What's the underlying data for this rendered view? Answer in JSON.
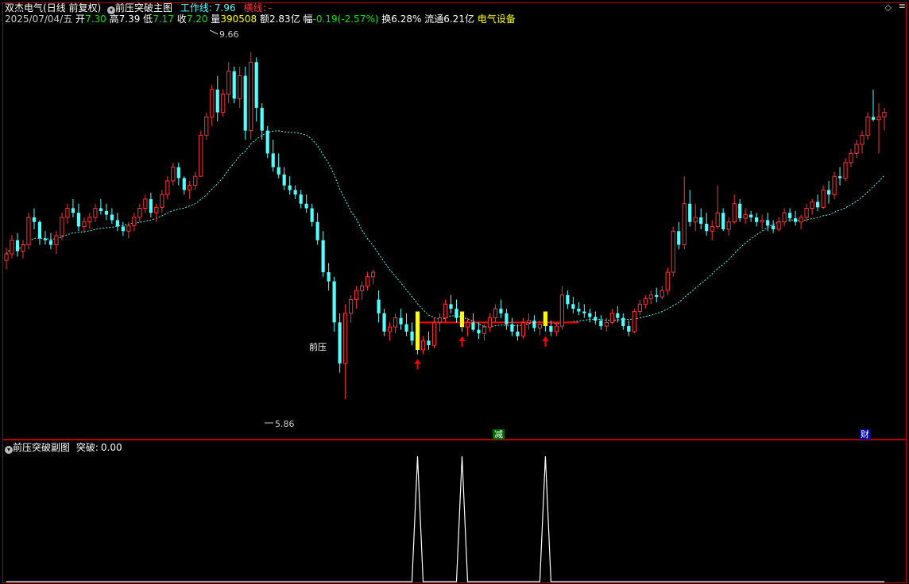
{
  "header": {
    "stock_name": "双杰电气",
    "period": "(日线 前复权)",
    "indicator_title": "前压突破主图",
    "work_line_label": "工作线:",
    "work_line_value": "7.96",
    "hline_label": "横线:",
    "hline_value": "-",
    "date": "2025/07/04/五",
    "open_label": "开",
    "open": "7.30",
    "high_label": "高",
    "high": "7.39",
    "low_label": "低",
    "low": "7.17",
    "close_label": "收",
    "close": "7.20",
    "volume_label": "量",
    "volume": "390508",
    "amount_label": "额",
    "amount": "2.83亿",
    "change_label": "幅",
    "change": "-0.19(-2.57%)",
    "turnover_label": "换",
    "turnover": "6.28%",
    "float_label": "流通",
    "float": "6.21亿",
    "sector": "电气设备"
  },
  "sub_header": {
    "title": "前压突破副图",
    "signal_label": "突破:",
    "signal_value": "0.00"
  },
  "annotations": {
    "high_label": "9.66",
    "low_label": "5.86",
    "pressure_label": "前压",
    "event_reduce": "减",
    "event_finance": "财"
  },
  "icons": {
    "indicator_toggle": "chevron-circle-icon",
    "corner": "diamond-icon"
  },
  "colors": {
    "up": "#ff3232",
    "down": "#54ffff",
    "ma": "#54ffff",
    "signal_bar": "#ffff00",
    "pressure_line": "#ff0000",
    "arrow": "#ff0000",
    "panel_border": "#b40000",
    "sub_line": "#ffffff"
  },
  "chart_data": [
    {
      "type": "candlestick",
      "title": "前压突破主图",
      "y_range": [
        5.6,
        9.9
      ],
      "candles": [
        [
          7.38,
          7.52,
          7.28,
          7.45
        ],
        [
          7.45,
          7.66,
          7.4,
          7.6
        ],
        [
          7.6,
          7.68,
          7.42,
          7.48
        ],
        [
          7.48,
          7.6,
          7.4,
          7.55
        ],
        [
          7.55,
          7.9,
          7.5,
          7.85
        ],
        [
          7.85,
          7.95,
          7.72,
          7.8
        ],
        [
          7.8,
          7.82,
          7.55,
          7.62
        ],
        [
          7.62,
          7.7,
          7.55,
          7.6
        ],
        [
          7.6,
          7.68,
          7.5,
          7.55
        ],
        [
          7.55,
          7.7,
          7.45,
          7.65
        ],
        [
          7.65,
          7.9,
          7.6,
          7.85
        ],
        [
          7.85,
          8.0,
          7.78,
          7.95
        ],
        [
          7.95,
          8.05,
          7.85,
          7.9
        ],
        [
          7.9,
          8.0,
          7.7,
          7.75
        ],
        [
          7.75,
          7.85,
          7.68,
          7.8
        ],
        [
          7.8,
          7.9,
          7.72,
          7.85
        ],
        [
          7.85,
          8.0,
          7.8,
          7.95
        ],
        [
          7.95,
          8.05,
          7.88,
          7.92
        ],
        [
          7.92,
          8.0,
          7.82,
          7.88
        ],
        [
          7.88,
          7.95,
          7.78,
          7.82
        ],
        [
          7.82,
          7.9,
          7.7,
          7.75
        ],
        [
          7.75,
          7.8,
          7.65,
          7.7
        ],
        [
          7.7,
          7.8,
          7.62,
          7.76
        ],
        [
          7.76,
          7.9,
          7.7,
          7.85
        ],
        [
          7.85,
          8.0,
          7.8,
          7.95
        ],
        [
          7.95,
          8.1,
          7.9,
          8.05
        ],
        [
          8.05,
          8.12,
          7.85,
          7.9
        ],
        [
          7.9,
          8.0,
          7.8,
          7.96
        ],
        [
          7.96,
          8.15,
          7.9,
          8.1
        ],
        [
          8.1,
          8.3,
          8.05,
          8.25
        ],
        [
          8.25,
          8.45,
          8.2,
          8.4
        ],
        [
          8.4,
          8.45,
          8.2,
          8.28
        ],
        [
          8.28,
          8.3,
          8.1,
          8.15
        ],
        [
          8.15,
          8.25,
          8.05,
          8.2
        ],
        [
          8.2,
          8.35,
          8.15,
          8.3
        ],
        [
          8.3,
          8.8,
          8.3,
          8.75
        ],
        [
          8.75,
          9.0,
          8.7,
          8.95
        ],
        [
          8.95,
          9.3,
          8.85,
          9.25
        ],
        [
          9.25,
          9.4,
          8.9,
          9.0
        ],
        [
          9.0,
          9.25,
          8.95,
          9.2
        ],
        [
          9.2,
          9.55,
          9.1,
          9.45
        ],
        [
          9.45,
          9.5,
          9.1,
          9.15
        ],
        [
          9.15,
          9.5,
          9.05,
          9.4
        ],
        [
          9.4,
          9.5,
          8.7,
          8.8
        ],
        [
          8.8,
          9.66,
          8.7,
          9.55
        ],
        [
          9.55,
          9.6,
          8.9,
          9.05
        ],
        [
          9.05,
          9.1,
          8.7,
          8.8
        ],
        [
          8.8,
          8.85,
          8.5,
          8.55
        ],
        [
          8.55,
          8.7,
          8.35,
          8.4
        ],
        [
          8.4,
          8.55,
          8.28,
          8.32
        ],
        [
          8.32,
          8.4,
          8.15,
          8.2
        ],
        [
          8.2,
          8.3,
          8.1,
          8.15
        ],
        [
          8.15,
          8.2,
          8.05,
          8.1
        ],
        [
          8.1,
          8.15,
          7.95,
          8.0
        ],
        [
          8.0,
          8.1,
          7.9,
          7.95
        ],
        [
          7.95,
          8.0,
          7.75,
          7.8
        ],
        [
          7.8,
          7.9,
          7.55,
          7.6
        ],
        [
          7.6,
          7.7,
          7.2,
          7.25
        ],
        [
          7.25,
          7.35,
          7.05,
          7.15
        ],
        [
          7.15,
          7.2,
          6.6,
          6.7
        ],
        [
          6.7,
          6.8,
          6.15,
          6.25
        ],
        [
          6.25,
          6.9,
          5.86,
          6.8
        ],
        [
          6.8,
          7.0,
          6.7,
          6.95
        ],
        [
          6.95,
          7.1,
          6.85,
          7.05
        ],
        [
          7.05,
          7.15,
          6.95,
          7.1
        ],
        [
          7.1,
          7.25,
          7.05,
          7.2
        ],
        [
          7.2,
          7.28,
          7.12,
          7.25
        ],
        [
          6.95,
          7.05,
          6.7,
          6.8
        ],
        [
          6.8,
          6.85,
          6.55,
          6.6
        ],
        [
          6.6,
          6.7,
          6.5,
          6.65
        ],
        [
          6.65,
          6.8,
          6.58,
          6.75
        ],
        [
          6.75,
          6.85,
          6.62,
          6.68
        ],
        [
          6.68,
          6.8,
          6.55,
          6.6
        ],
        [
          6.6,
          6.7,
          6.45,
          6.5
        ],
        [
          6.5,
          6.55,
          6.35,
          6.4
        ],
        [
          6.4,
          6.55,
          6.35,
          6.5
        ],
        [
          6.5,
          6.6,
          6.4,
          6.45
        ],
        [
          6.45,
          6.75,
          6.42,
          6.7
        ],
        [
          6.7,
          6.8,
          6.6,
          6.75
        ],
        [
          6.75,
          6.95,
          6.7,
          6.9
        ],
        [
          6.9,
          7.0,
          6.8,
          6.85
        ],
        [
          6.85,
          6.95,
          6.7,
          6.75
        ],
        [
          6.75,
          6.8,
          6.6,
          6.65
        ],
        [
          6.65,
          6.75,
          6.55,
          6.7
        ],
        [
          6.7,
          6.8,
          6.6,
          6.62
        ],
        [
          6.62,
          6.7,
          6.52,
          6.58
        ],
        [
          6.58,
          6.68,
          6.5,
          6.65
        ],
        [
          6.65,
          6.8,
          6.6,
          6.75
        ],
        [
          6.75,
          6.9,
          6.7,
          6.85
        ],
        [
          6.85,
          6.95,
          6.75,
          6.8
        ],
        [
          6.8,
          6.85,
          6.62,
          6.68
        ],
        [
          6.68,
          6.75,
          6.55,
          6.6
        ],
        [
          6.6,
          6.68,
          6.5,
          6.55
        ],
        [
          6.55,
          6.75,
          6.52,
          6.7
        ],
        [
          6.7,
          6.8,
          6.62,
          6.72
        ],
        [
          6.72,
          6.78,
          6.6,
          6.64
        ],
        [
          6.64,
          6.72,
          6.56,
          6.68
        ],
        [
          6.68,
          6.75,
          6.6,
          6.66
        ],
        [
          6.66,
          6.72,
          6.55,
          6.6
        ],
        [
          6.6,
          6.7,
          6.55,
          6.66
        ],
        [
          6.66,
          7.1,
          6.62,
          7.0
        ],
        [
          7.0,
          7.05,
          6.85,
          6.9
        ],
        [
          6.9,
          6.98,
          6.8,
          6.85
        ],
        [
          6.85,
          6.92,
          6.78,
          6.82
        ],
        [
          6.82,
          6.9,
          6.75,
          6.8
        ],
        [
          6.8,
          6.85,
          6.7,
          6.76
        ],
        [
          6.76,
          6.82,
          6.68,
          6.72
        ],
        [
          6.72,
          6.78,
          6.62,
          6.66
        ],
        [
          6.66,
          6.75,
          6.6,
          6.7
        ],
        [
          6.7,
          6.85,
          6.68,
          6.8
        ],
        [
          6.8,
          6.88,
          6.7,
          6.75
        ],
        [
          6.75,
          6.8,
          6.62,
          6.66
        ],
        [
          6.66,
          6.72,
          6.55,
          6.6
        ],
        [
          6.6,
          6.85,
          6.58,
          6.82
        ],
        [
          6.82,
          6.95,
          6.78,
          6.9
        ],
        [
          6.9,
          7.0,
          6.85,
          6.96
        ],
        [
          6.96,
          7.05,
          6.9,
          7.0
        ],
        [
          7.0,
          7.08,
          6.92,
          6.98
        ],
        [
          6.98,
          7.1,
          6.95,
          7.05
        ],
        [
          7.05,
          7.3,
          7.0,
          7.25
        ],
        [
          7.25,
          7.75,
          7.2,
          7.7
        ],
        [
          7.7,
          7.8,
          7.5,
          7.55
        ],
        [
          7.55,
          8.3,
          7.5,
          8.0
        ],
        [
          8.0,
          8.15,
          7.75,
          7.8
        ],
        [
          7.8,
          8.0,
          7.7,
          7.85
        ],
        [
          7.85,
          7.95,
          7.72,
          7.78
        ],
        [
          7.78,
          7.9,
          7.65,
          7.7
        ],
        [
          7.7,
          7.82,
          7.6,
          7.75
        ],
        [
          7.75,
          8.2,
          7.72,
          7.9
        ],
        [
          7.9,
          7.95,
          7.7,
          7.72
        ],
        [
          7.72,
          7.85,
          7.65,
          7.8
        ],
        [
          7.8,
          8.1,
          7.78,
          8.0
        ],
        [
          8.0,
          8.05,
          7.8,
          7.84
        ],
        [
          7.84,
          7.95,
          7.78,
          7.88
        ],
        [
          7.88,
          7.92,
          7.8,
          7.85
        ],
        [
          7.85,
          7.9,
          7.75,
          7.8
        ],
        [
          7.8,
          7.88,
          7.72,
          7.82
        ],
        [
          7.82,
          7.9,
          7.7,
          7.76
        ],
        [
          7.76,
          7.82,
          7.68,
          7.72
        ],
        [
          7.72,
          7.85,
          7.7,
          7.8
        ],
        [
          7.8,
          7.95,
          7.75,
          7.9
        ],
        [
          7.9,
          7.95,
          7.8,
          7.84
        ],
        [
          7.84,
          7.92,
          7.76,
          7.8
        ],
        [
          7.8,
          7.88,
          7.72,
          7.85
        ],
        [
          7.85,
          8.0,
          7.8,
          7.95
        ],
        [
          7.95,
          8.05,
          7.88,
          8.02
        ],
        [
          8.02,
          8.1,
          7.92,
          7.96
        ],
        [
          7.96,
          8.2,
          7.94,
          8.15
        ],
        [
          8.15,
          8.25,
          8.0,
          8.1
        ],
        [
          8.1,
          8.35,
          8.05,
          8.3
        ],
        [
          8.3,
          8.4,
          8.2,
          8.28
        ],
        [
          8.28,
          8.5,
          8.25,
          8.45
        ],
        [
          8.45,
          8.6,
          8.4,
          8.55
        ],
        [
          8.55,
          8.7,
          8.5,
          8.65
        ],
        [
          8.65,
          8.8,
          8.55,
          8.75
        ],
        [
          8.75,
          9.0,
          8.7,
          8.95
        ],
        [
          8.95,
          9.25,
          8.9,
          8.92
        ],
        [
          8.92,
          9.1,
          8.55,
          8.95
        ],
        [
          8.95,
          9.05,
          8.8,
          9.0
        ]
      ],
      "ma_line": "dashed, period ~20",
      "high_marker": 9.66,
      "low_marker": 5.86,
      "pressure_level": 6.7,
      "signal_candle_indices": [
        74,
        82,
        97
      ]
    },
    {
      "type": "line",
      "title": "前压突破副图",
      "series": [
        {
          "name": "突破",
          "values": [
            0,
            0,
            0,
            0,
            0,
            0,
            0,
            0,
            0,
            0,
            0,
            0,
            0,
            0,
            0,
            0,
            0,
            0,
            0,
            0,
            0,
            0,
            0,
            0,
            0,
            0,
            0,
            0,
            0,
            0,
            0,
            0,
            0,
            0,
            0,
            0,
            0,
            0,
            0,
            0,
            0,
            0,
            0,
            0,
            0,
            0,
            0,
            0,
            0,
            0,
            0,
            0,
            0,
            0,
            0,
            0,
            0,
            0,
            0,
            0,
            0,
            0,
            0,
            0,
            0,
            0,
            0,
            0,
            0,
            0,
            0,
            0,
            0,
            0,
            1,
            0,
            0,
            0,
            0,
            0,
            0,
            0,
            1,
            0,
            0,
            0,
            0,
            0,
            0,
            0,
            0,
            0,
            0,
            0,
            0,
            0,
            0,
            1,
            0,
            0,
            0,
            0,
            0,
            0,
            0,
            0,
            0,
            0,
            0,
            0,
            0,
            0,
            0,
            0,
            0,
            0,
            0,
            0,
            0,
            0,
            0,
            0,
            0,
            0,
            0,
            0,
            0,
            0,
            0,
            0,
            0,
            0,
            0,
            0,
            0,
            0,
            0,
            0,
            0,
            0,
            0,
            0,
            0,
            0,
            0,
            0,
            0,
            0,
            0,
            0,
            0,
            0,
            0,
            0,
            0,
            0,
            0,
            0,
            0,
            0,
            0,
            0,
            0
          ]
        }
      ],
      "y_range": [
        0,
        1
      ]
    }
  ]
}
